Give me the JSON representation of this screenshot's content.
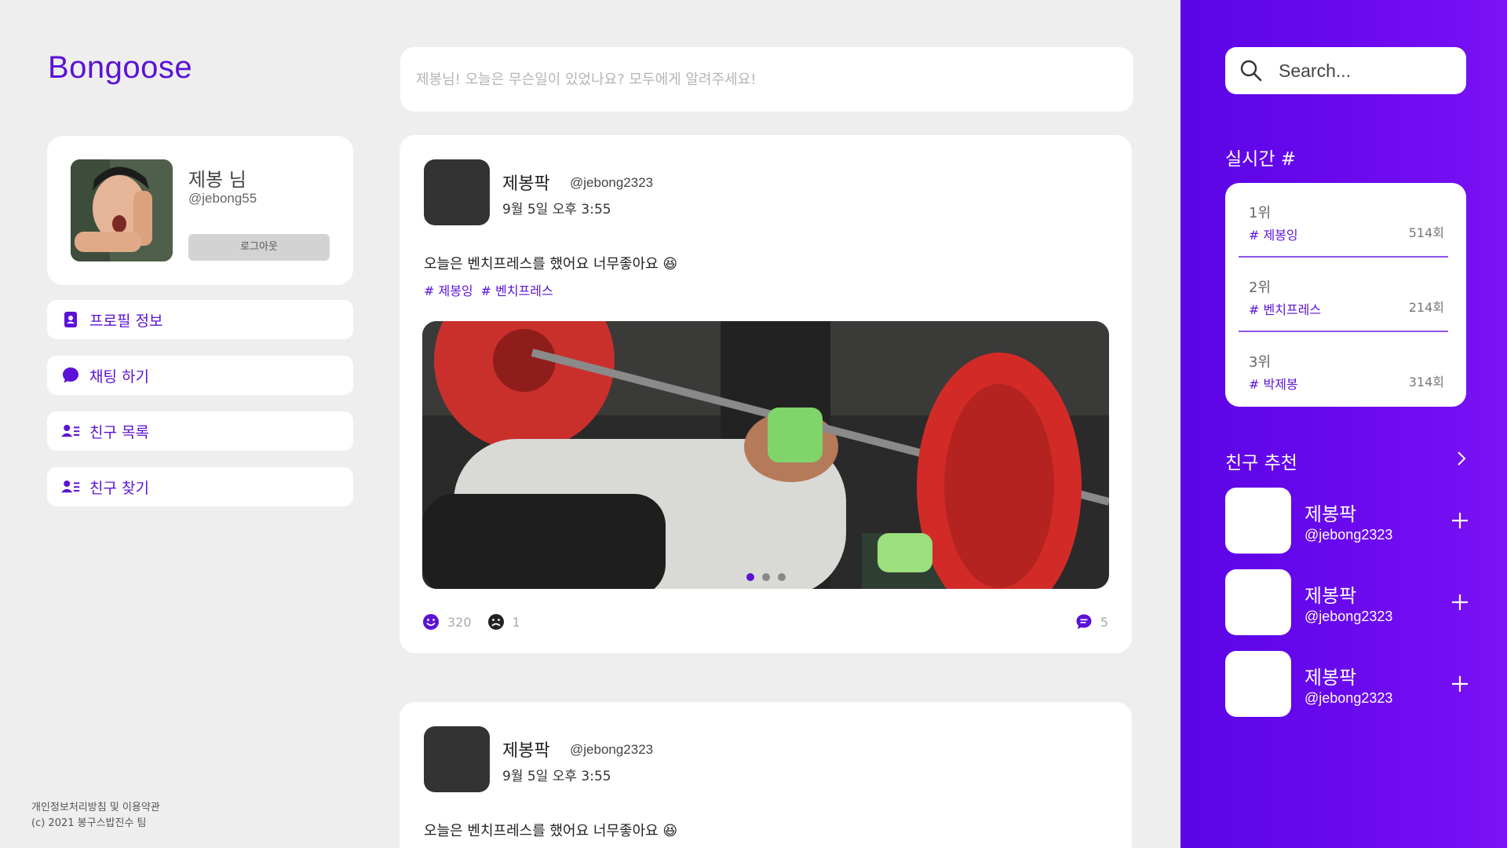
{
  "app": {
    "logo": "Bongoose"
  },
  "profile": {
    "name": "제봉 님",
    "handle": "@jebong55",
    "logout_label": "로그아웃"
  },
  "menu": [
    {
      "label": "프로필 정보",
      "icon": "id-card-icon"
    },
    {
      "label": "채팅 하기",
      "icon": "chat-bubble-icon"
    },
    {
      "label": "친구 목록",
      "icon": "user-list-icon"
    },
    {
      "label": "친구 찾기",
      "icon": "user-list-icon"
    }
  ],
  "footer": {
    "line1": "개인정보처리방침 및 이용약관",
    "line2": "(c) 2021 봉구스밥진수 팀"
  },
  "compose": {
    "placeholder": "제봉님! 오늘은 무슨일이 있었나요? 모두에게 알려주세요!"
  },
  "posts": [
    {
      "author": "제봉팍",
      "handle": "@jebong2323",
      "time": "9월 5일 오후 3:55",
      "text": "오늘은 벤치프레스를 했어요 너무좋아요 😆",
      "tags": [
        "# 제봉잉",
        "# 벤치프레스"
      ],
      "likes": "320",
      "dislikes": "1",
      "comments": "5"
    },
    {
      "author": "제봉팍",
      "handle": "@jebong2323",
      "time": "9월 5일 오후 3:55",
      "text": "오늘은 벤치프레스를 했어요 너무좋아요 😆"
    }
  ],
  "search": {
    "placeholder": "Search..."
  },
  "trending": {
    "title": "실시간 #",
    "items": [
      {
        "rank": "1위",
        "tag": "# 제봉잉",
        "count": "514회"
      },
      {
        "rank": "2위",
        "tag": "# 벤치프레스",
        "count": "214회"
      },
      {
        "rank": "3위",
        "tag": "# 박제봉",
        "count": "314회"
      }
    ]
  },
  "suggestions": {
    "title": "친구 추천",
    "items": [
      {
        "name": "제봉팍",
        "handle": "@jebong2323"
      },
      {
        "name": "제봉팍",
        "handle": "@jebong2323"
      },
      {
        "name": "제봉팍",
        "handle": "@jebong2323"
      }
    ]
  },
  "colors": {
    "accent": "#5b12d6",
    "panel": "#6a08ee",
    "background": "#eeeeee"
  }
}
